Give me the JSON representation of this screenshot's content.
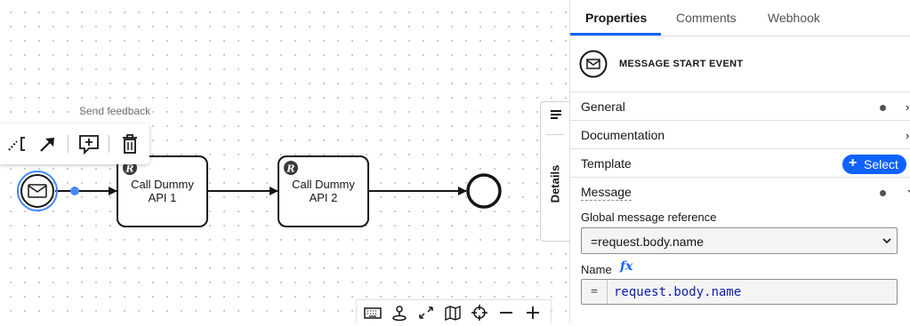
{
  "canvas": {
    "send_feedback": "Send feedback",
    "tasks": [
      {
        "line1": "Call Dummy",
        "line2": "API 1",
        "marker": "R"
      },
      {
        "line1": "Call Dummy",
        "line2": "API 2",
        "marker": "R"
      }
    ],
    "context_pad_icons": [
      "connect-icon",
      "arrow-icon",
      "comment-icon",
      "trash-icon"
    ],
    "toolbar_icons": [
      "keyboard-icon",
      "focus-icon",
      "fullscreen-icon",
      "map-icon",
      "crosshair-icon",
      "zoom-out-icon",
      "zoom-in-icon"
    ]
  },
  "details_tab": {
    "label": "Details"
  },
  "panel": {
    "tabs": [
      {
        "label": "Properties",
        "active": true
      },
      {
        "label": "Comments",
        "active": false
      },
      {
        "label": "Webhook",
        "active": false
      }
    ],
    "element": {
      "title": "MESSAGE START EVENT",
      "icon": "envelope-icon"
    },
    "groups": {
      "general": "General",
      "documentation": "Documentation",
      "template": "Template",
      "template_button": "Select",
      "message": "Message"
    },
    "message": {
      "global_ref_label": "Global message reference",
      "global_ref_value": "=request.body.name",
      "name_label": "Name",
      "fx": "fx",
      "expr_prefix": "=",
      "expr_value": "request.body.name"
    }
  },
  "colors": {
    "accent": "#0f62fe",
    "selection": "#4589ff"
  }
}
